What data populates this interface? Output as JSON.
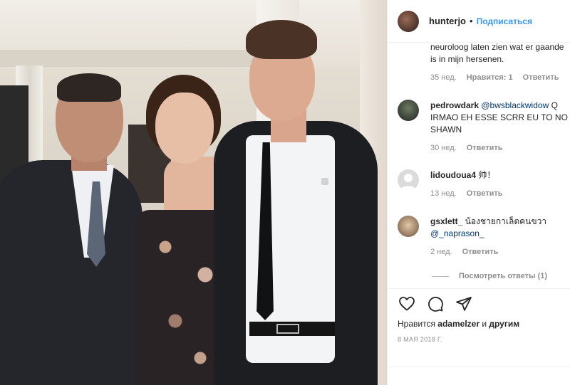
{
  "header": {
    "username": "hunterjo",
    "separator": "•",
    "follow_label": "Подписаться"
  },
  "comments": [
    {
      "text": "neuroloog laten zien wat er gaande is in mijn hersenen.",
      "age": "35 нед.",
      "likes": "Нравится: 1",
      "reply": "Ответить"
    },
    {
      "user": "pedrowdark",
      "mention": "@bwsblackwidow",
      "text": "Q IRMAO EH ESSE SCRR EU TO NO SHAWN",
      "age": "30 нед.",
      "reply": "Ответить"
    },
    {
      "user": "lidoudoua4",
      "text": "帅！",
      "age": "13 нед.",
      "reply": "Ответить"
    },
    {
      "user": "gsxlett_",
      "text": "น้องชายกาเล็ตคนขวา",
      "mention": "@_naprason_",
      "age": "2 нед.",
      "reply": "Ответить"
    }
  ],
  "view_replies": "Посмотреть ответы (1)",
  "likes": {
    "prefix": "Нравится",
    "user": "adamelzer",
    "conj": "и",
    "others": "другим"
  },
  "date": "8 МАЯ 2018 Г.",
  "icons": [
    "heart-icon",
    "comment-icon",
    "share-icon"
  ],
  "colors": {
    "link": "#3897f0",
    "mention": "#003569",
    "meta": "#8e8e8e"
  }
}
